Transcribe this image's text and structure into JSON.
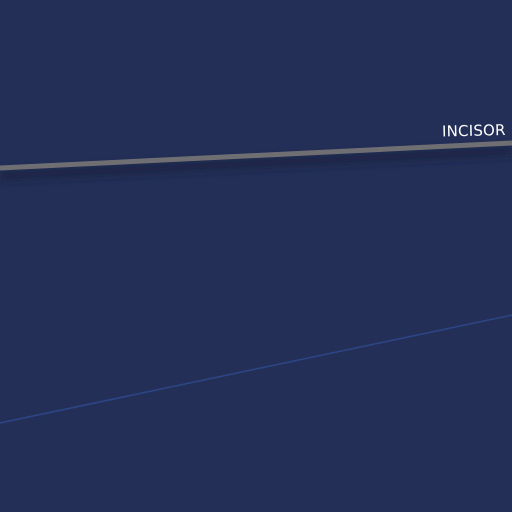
{
  "map": {
    "background_color": "#232f57",
    "roads": [
      {
        "name": "INCISOR",
        "color": "#6f6f73",
        "casing_color": "#1a2340"
      }
    ],
    "minor_lines": [
      {
        "color": "#2c4585"
      }
    ]
  }
}
